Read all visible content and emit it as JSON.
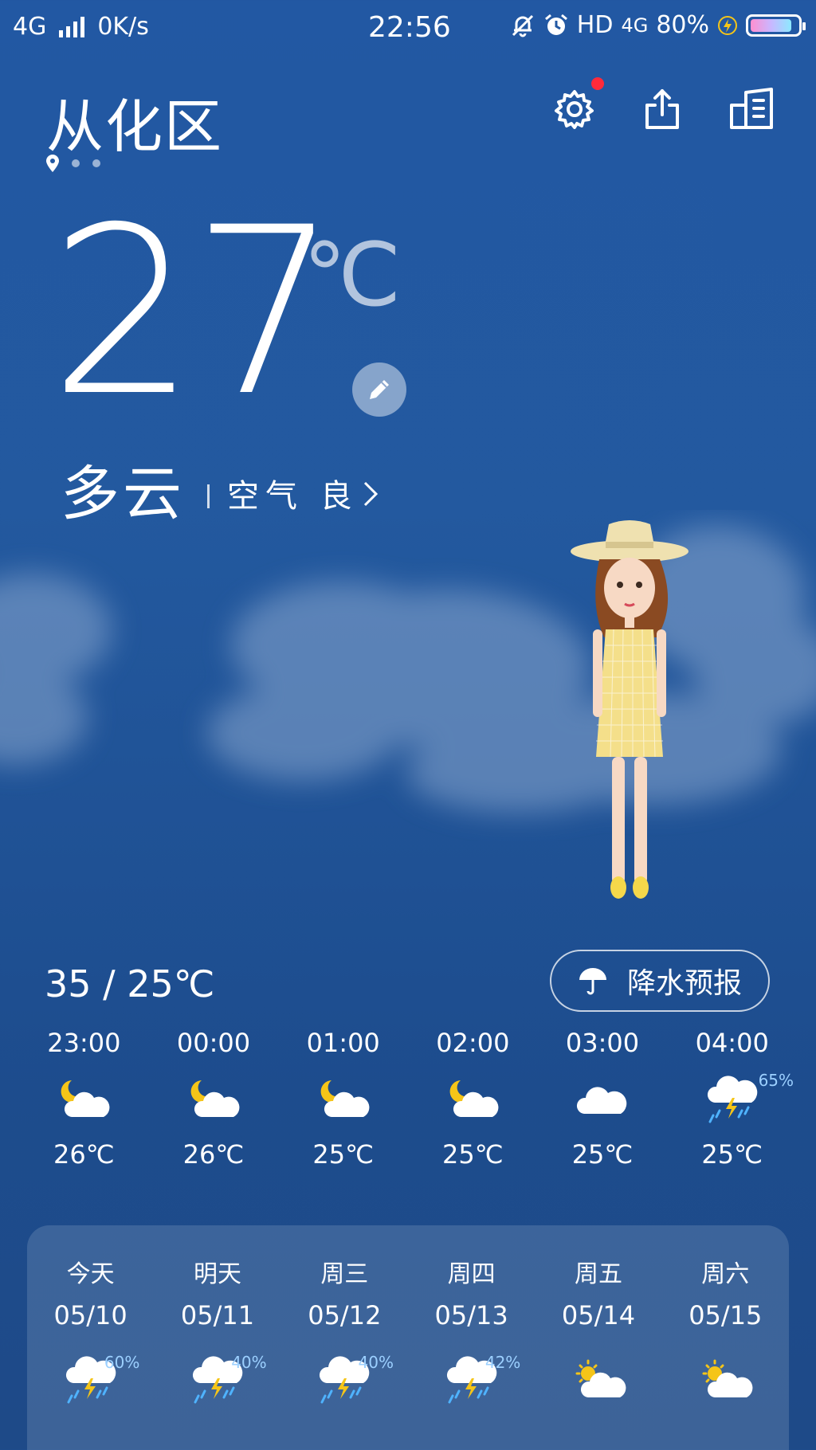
{
  "status_bar": {
    "network": "4G",
    "speed": "0K/s",
    "time": "22:56",
    "hd": "HD",
    "network_right": "4G",
    "battery": "80%",
    "battery_level": 0.8
  },
  "header": {
    "city": "从化区"
  },
  "current": {
    "temp": "27",
    "unit": "℃",
    "condition": "多云",
    "air_quality": "空气 良"
  },
  "range": "35 / 25℃",
  "rain_forecast_label": "降水预报",
  "hourly": [
    {
      "time": "23:00",
      "icon": "night-cloudy-icon",
      "temp": "26℃",
      "pct": ""
    },
    {
      "time": "00:00",
      "icon": "night-cloudy-icon",
      "temp": "26℃",
      "pct": ""
    },
    {
      "time": "01:00",
      "icon": "night-cloudy-icon",
      "temp": "25℃",
      "pct": ""
    },
    {
      "time": "02:00",
      "icon": "night-cloudy-icon",
      "temp": "25℃",
      "pct": ""
    },
    {
      "time": "03:00",
      "icon": "cloud-icon",
      "temp": "25℃",
      "pct": ""
    },
    {
      "time": "04:00",
      "icon": "thunderstorm-icon",
      "temp": "25℃",
      "pct": "65%"
    }
  ],
  "daily": [
    {
      "day": "今天",
      "date": "05/10",
      "icon": "thunderstorm-icon",
      "pct": "60%"
    },
    {
      "day": "明天",
      "date": "05/11",
      "icon": "thunderstorm-icon",
      "pct": "40%"
    },
    {
      "day": "周三",
      "date": "05/12",
      "icon": "thunderstorm-icon",
      "pct": "40%"
    },
    {
      "day": "周四",
      "date": "05/13",
      "icon": "thunderstorm-icon",
      "pct": "42%"
    },
    {
      "day": "周五",
      "date": "05/14",
      "icon": "partly-sunny-icon",
      "pct": ""
    },
    {
      "day": "周六",
      "date": "05/15",
      "icon": "partly-sunny-icon",
      "pct": ""
    }
  ],
  "colors": {
    "background": "#2258a3",
    "notification_dot": "#ff2a3a",
    "moon": "#f5c518",
    "rain": "#4fb3ff"
  }
}
